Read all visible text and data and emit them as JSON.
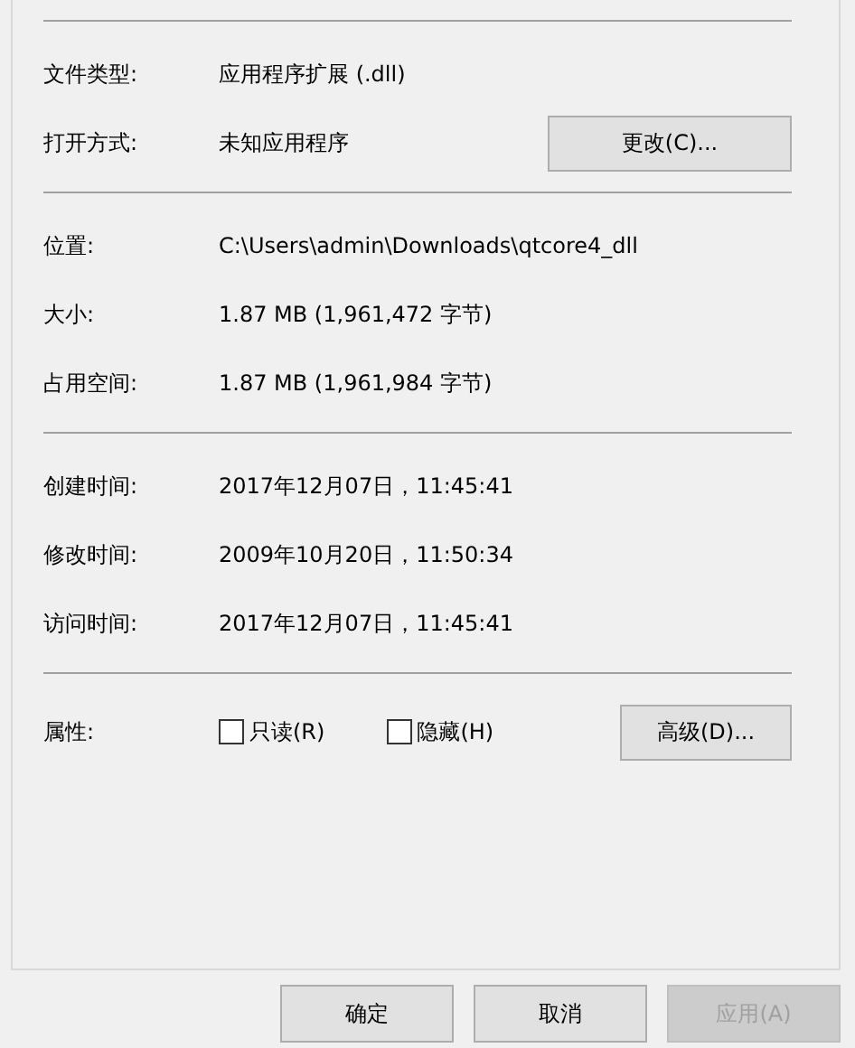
{
  "sections": [
    {
      "rows": [
        {
          "label": "文件类型:",
          "value": "应用程序扩展 (.dll)"
        },
        {
          "label": "打开方式:",
          "value": "未知应用程序",
          "button": "更改(C)..."
        }
      ]
    },
    {
      "rows": [
        {
          "label": "位置:",
          "value": "C:\\Users\\admin\\Downloads\\qtcore4_dll"
        },
        {
          "label": "大小:",
          "value": "1.87 MB (1,961,472 字节)"
        },
        {
          "label": "占用空间:",
          "value": "1.87 MB (1,961,984 字节)"
        }
      ]
    },
    {
      "rows": [
        {
          "label": "创建时间:",
          "value": "2017年12月07日，11:45:41"
        },
        {
          "label": "修改时间:",
          "value": "2009年10月20日，11:50:34"
        },
        {
          "label": "访问时间:",
          "value": "2017年12月07日，11:45:41"
        }
      ]
    }
  ],
  "attributes": {
    "label": "属性:",
    "checkboxes": [
      {
        "label": "只读(R)",
        "checked": false
      },
      {
        "label": "隐藏(H)",
        "checked": false
      }
    ],
    "button": "高级(D)..."
  },
  "buttons": [
    {
      "label": "确定",
      "disabled": false
    },
    {
      "label": "取消",
      "disabled": false
    },
    {
      "label": "应用(A)",
      "disabled": true
    }
  ]
}
